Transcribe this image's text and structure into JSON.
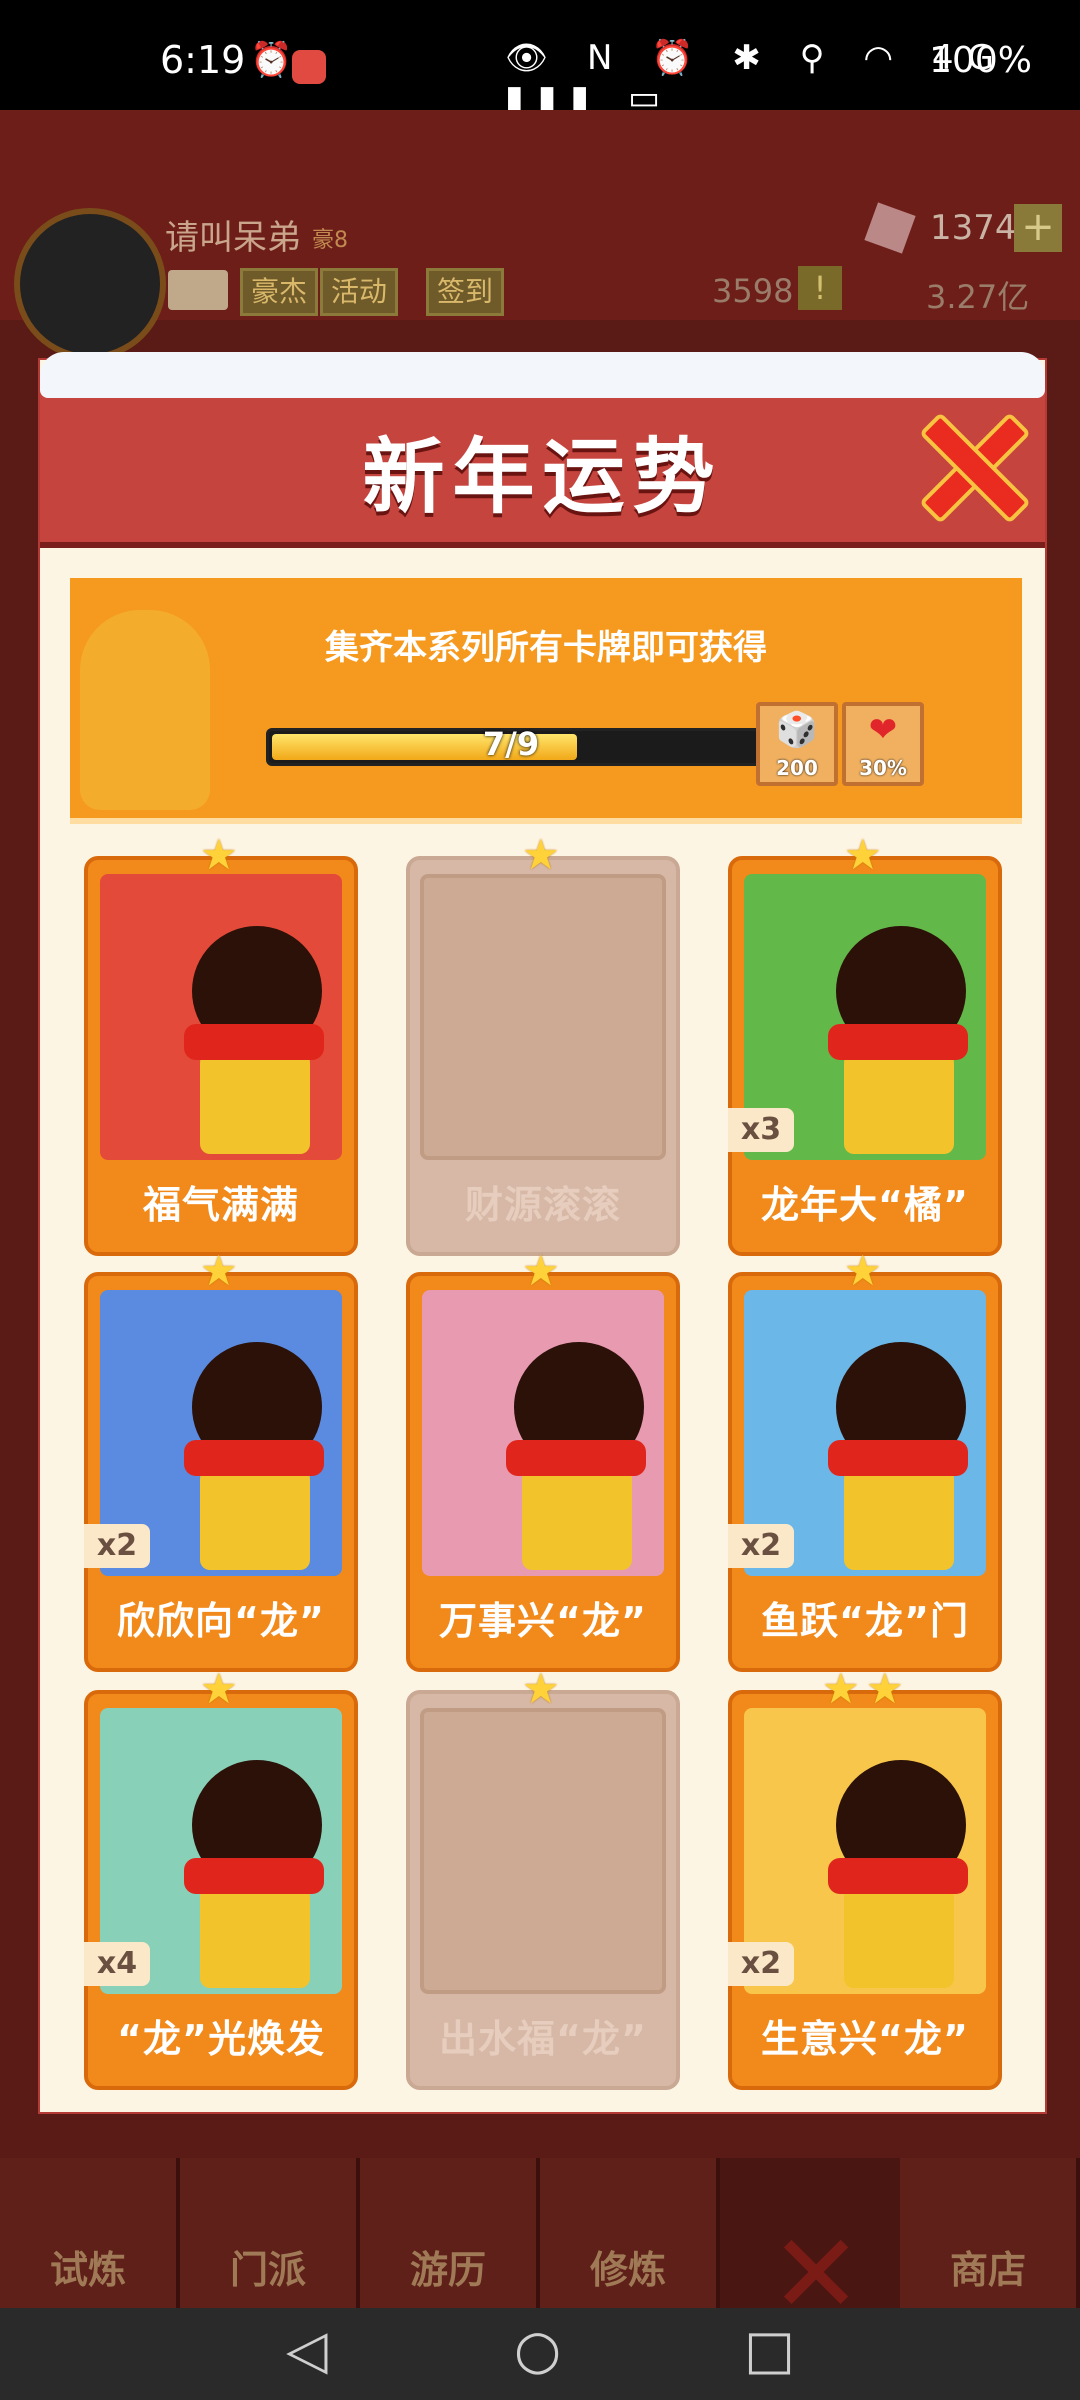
{
  "status_bar": {
    "time": "6:19",
    "battery": "100%",
    "icons": "👁 N ⏰ ✱ ⚲ ◠ 4G ▮▮▮ ▭"
  },
  "game": {
    "player_name": "请叫呆弟",
    "player_level": "豪8",
    "tags": [
      "豪杰",
      "活动",
      "签到"
    ],
    "gems": "1374",
    "currency_a": "3598",
    "currency_b": "3.27亿",
    "nav": [
      "试炼",
      "门派",
      "游历",
      "修炼",
      "商店"
    ]
  },
  "modal": {
    "title": "新年运势",
    "banner_text": "集齐本系列所有卡牌即可获得",
    "progress": {
      "current": 7,
      "total": 9,
      "text": "7/9"
    },
    "rewards": [
      {
        "icon": "dice-icon",
        "glyph": "🎲",
        "amount": "200"
      },
      {
        "icon": "heart-icon",
        "glyph": "❤",
        "amount": "30%"
      }
    ],
    "cards": [
      {
        "name": "福气满满",
        "owned": true,
        "stars": 1,
        "count": "",
        "bg": "#e44a3a"
      },
      {
        "name": "财源滚滚",
        "owned": false,
        "stars": 1,
        "count": "",
        "bg": ""
      },
      {
        "name": "龙年大“橘”",
        "owned": true,
        "stars": 1,
        "count": "x3",
        "bg": "#63b84a"
      },
      {
        "name": "欣欣向“龙”",
        "owned": true,
        "stars": 1,
        "count": "x2",
        "bg": "#5a8be0"
      },
      {
        "name": "万事兴“龙”",
        "owned": true,
        "stars": 1,
        "count": "",
        "bg": "#e89ab0"
      },
      {
        "name": "鱼跃“龙”门",
        "owned": true,
        "stars": 1,
        "count": "x2",
        "bg": "#6ab7e8"
      },
      {
        "name": "“龙”光焕发",
        "owned": true,
        "stars": 1,
        "count": "x4",
        "bg": "#88d0b8"
      },
      {
        "name": "出水福“龙”",
        "owned": false,
        "stars": 1,
        "count": "",
        "bg": ""
      },
      {
        "name": "生意兴“龙”",
        "owned": true,
        "stars": 2,
        "count": "x2",
        "bg": "#f7c64a"
      }
    ]
  },
  "system_nav": {
    "back": "◁",
    "home": "○",
    "recent": "□"
  }
}
